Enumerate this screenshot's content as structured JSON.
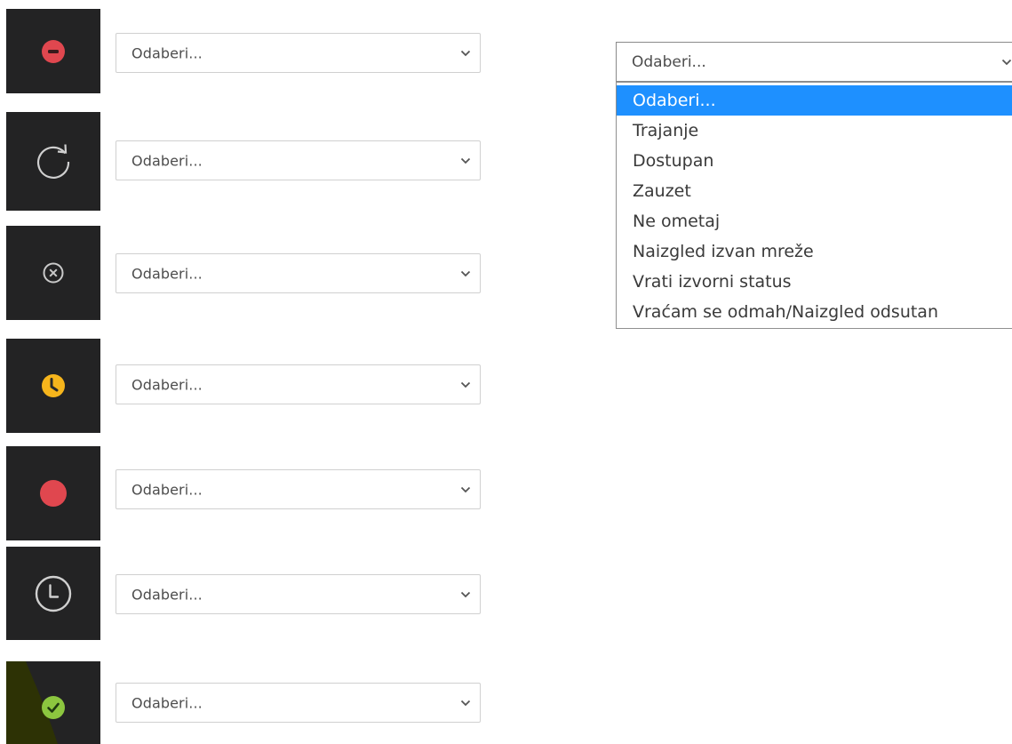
{
  "rows": [
    {
      "icon": "do-not-disturb-icon",
      "select_value": "Odaberi..."
    },
    {
      "icon": "refresh-icon",
      "select_value": "Odaberi..."
    },
    {
      "icon": "close-circle-icon",
      "select_value": "Odaberi..."
    },
    {
      "icon": "away-clock-icon",
      "select_value": "Odaberi..."
    },
    {
      "icon": "busy-dot-icon",
      "select_value": "Odaberi..."
    },
    {
      "icon": "clock-outline-icon",
      "select_value": "Odaberi..."
    },
    {
      "icon": "available-check-icon",
      "select_value": "Odaberi..."
    }
  ],
  "dropdown": {
    "value": "Odaberi...",
    "options": [
      "Odaberi...",
      "Trajanje",
      "Dostupan",
      "Zauzet",
      "Ne ometaj",
      "Naizgled izvan mreže",
      "Vrati izvorni status",
      "Vraćam se odmah/Naizgled odsutan"
    ],
    "selected_index": 0
  },
  "colors": {
    "tile_bg": "#232324",
    "red_status": "#e0474f",
    "away_yellow": "#f6b51c",
    "available_green": "#8cc63f",
    "option_highlight": "#1e90ff"
  }
}
